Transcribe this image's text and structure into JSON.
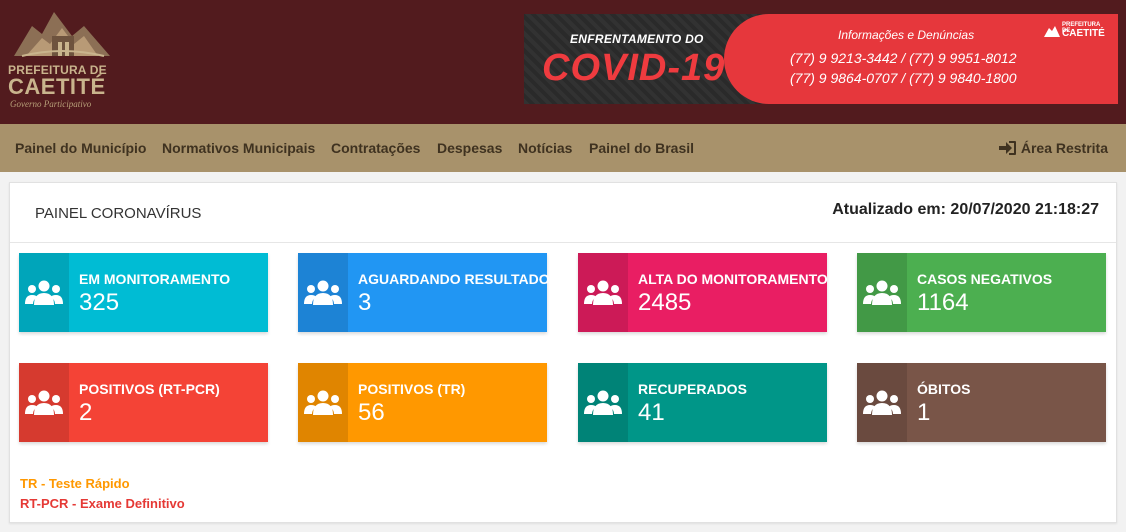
{
  "header": {
    "logo": {
      "line1": "PREFEITURA DE",
      "line2": "CAETITÉ",
      "line3": "Governo Participativo"
    },
    "banner": {
      "kicker": "ENFRENTAMENTO DO",
      "headline": "COVID-19",
      "info": "Informações e Denúncias",
      "phones_line1": "(77) 9 9213-3442  /  (77) 9 9951-8012",
      "phones_line2": "(77) 9 9864-0707  /  (77) 9 9840-1800",
      "mini_logo_line1": "PREFEITURA DE",
      "mini_logo_line2": "CAETITÉ"
    }
  },
  "nav": {
    "items": [
      {
        "label": "Painel do Município"
      },
      {
        "label": "Normativos Municipais"
      },
      {
        "label": "Contratações"
      },
      {
        "label": "Despesas"
      },
      {
        "label": "Notícias"
      },
      {
        "label": "Painel do Brasil"
      }
    ],
    "restricted": {
      "label": "Área Restrita",
      "icon": "sign-in-icon"
    }
  },
  "panel": {
    "title": "PAINEL CORONAVÍRUS",
    "updated": "Atualizado em: 20/07/2020 21:18:27",
    "cards": [
      {
        "label": "EM MONITORAMENTO",
        "value": "325",
        "color": "#00bcd4",
        "icon": "users-icon"
      },
      {
        "label": "AGUARDANDO RESULTADO",
        "value": "3",
        "color": "#2196f3",
        "icon": "users-icon"
      },
      {
        "label": "ALTA DO MONITORAMENTO",
        "value": "2485",
        "color": "#e91e63",
        "icon": "users-icon"
      },
      {
        "label": "CASOS NEGATIVOS",
        "value": "1164",
        "color": "#4caf50",
        "icon": "users-icon"
      },
      {
        "label": "POSITIVOS (RT-PCR)",
        "value": "2",
        "color": "#f44336",
        "icon": "users-icon"
      },
      {
        "label": "POSITIVOS (TR)",
        "value": "56",
        "color": "#ff9800",
        "icon": "users-icon"
      },
      {
        "label": "RECUPERADOS",
        "value": "41",
        "color": "#009688",
        "icon": "users-icon"
      },
      {
        "label": "ÓBITOS",
        "value": "1",
        "color": "#795548",
        "icon": "users-icon"
      }
    ],
    "legend": [
      {
        "text": "TR - Teste Rápido",
        "color": "#ff9800"
      },
      {
        "text": "RT-PCR - Exame Definitivo",
        "color": "#e53935"
      }
    ]
  },
  "colors": {
    "header_bg": "#521b1e",
    "nav_bg": "#a8926b",
    "banner_red": "#e6373c"
  }
}
